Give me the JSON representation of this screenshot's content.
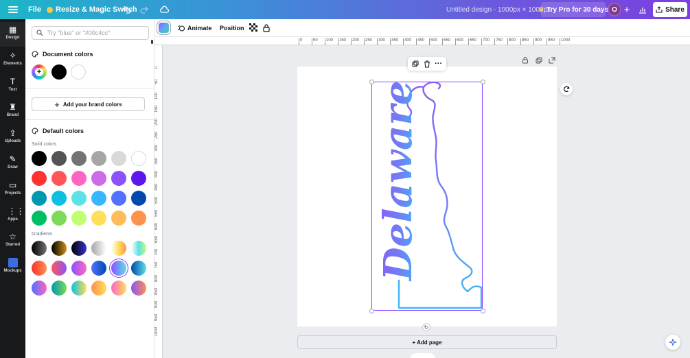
{
  "topbar": {
    "file_label": "File",
    "resize_label": "Resize & Magic Switch",
    "resize_icon": "magic-sparkle-icon",
    "undo_icon": "undo-icon",
    "redo_icon": "redo-icon",
    "cloud_icon": "cloud-save-icon",
    "document_title": "Untitled design - 1000px × 1000px",
    "try_pro_label": "Try Pro for 30 days",
    "avatar_initial": "O",
    "share_label": "Share"
  },
  "rail": {
    "items": [
      {
        "label": "Design",
        "icon": "design-icon",
        "active": true
      },
      {
        "label": "Elements",
        "icon": "elements-icon"
      },
      {
        "label": "Text",
        "icon": "text-icon"
      },
      {
        "label": "Brand",
        "icon": "brand-icon"
      },
      {
        "label": "Uploads",
        "icon": "uploads-icon"
      },
      {
        "label": "Draw",
        "icon": "draw-icon"
      },
      {
        "label": "Projects",
        "icon": "projects-icon"
      },
      {
        "label": "Apps",
        "icon": "apps-icon"
      },
      {
        "label": "Starred",
        "icon": "star-icon"
      },
      {
        "label": "Mockups",
        "icon": "mockups-icon"
      }
    ]
  },
  "panel": {
    "search_placeholder": "Try \"blue\" or \"#00c4cc\"",
    "document_colors_title": "Document colors",
    "document_colors": [
      "#000000",
      "#ffffff"
    ],
    "add_brand_label": "Add your brand colors",
    "default_colors_title": "Default colors",
    "solid_colors_label": "Solid colors",
    "solid_colors": [
      [
        "#000000",
        "#545454",
        "#737373",
        "#a6a6a6",
        "#d9d9d9",
        "#ffffff"
      ],
      [
        "#ff3131",
        "#ff5757",
        "#ff66c4",
        "#cb6ce6",
        "#8c52ff",
        "#5e17eb"
      ],
      [
        "#0097b2",
        "#0cc0df",
        "#5ce1e6",
        "#38b6ff",
        "#5271ff",
        "#004aad"
      ],
      [
        "#00bf63",
        "#7ed957",
        "#c1ff72",
        "#ffde59",
        "#ffbd59",
        "#ff914d"
      ]
    ],
    "gradients_label": "Gradients",
    "gradients": [
      [
        "linear-gradient(90deg,#000000,#737373)",
        "linear-gradient(90deg,#000000,#c89116)",
        "linear-gradient(90deg,#000000,#3533cd)",
        "linear-gradient(90deg,#a6a6a6,#ffffff)",
        "linear-gradient(90deg,#ffffff,#ffde59,#ff914d)",
        "linear-gradient(90deg,#ffffff,#5de0e6,#c1ff72)"
      ],
      [
        "linear-gradient(90deg,#ff3131,#ff914d)",
        "linear-gradient(90deg,#ff5757,#8c52ff)",
        "linear-gradient(90deg,#8c52ff,#ff66c4)",
        "linear-gradient(90deg,#5170ff,#004aad)",
        "linear-gradient(90deg,#8c52ff,#5ce1e6)",
        "linear-gradient(90deg,#004aad,#5de0e6)"
      ],
      [
        "linear-gradient(90deg,#5170ff,#ff66c4)",
        "linear-gradient(90deg,#0097b2,#7ed957)",
        "linear-gradient(90deg,#0cc0df,#ffde59)",
        "linear-gradient(90deg,#ff914d,#ffde59)",
        "linear-gradient(90deg,#ff66c4,#ffde59)",
        "linear-gradient(90deg,#8c52ff,#ff914d)"
      ]
    ],
    "selected_gradient_index": [
      1,
      4
    ]
  },
  "ctxbar": {
    "animate_label": "Animate",
    "position_label": "Position",
    "transparency_icon": "transparency-icon",
    "lock_icon": "lock-icon"
  },
  "ruler": {
    "top_ticks": [
      "0",
      "50",
      "100",
      "150",
      "200",
      "250",
      "300",
      "350",
      "400",
      "450",
      "500",
      "550",
      "600",
      "650",
      "700",
      "750",
      "800",
      "850",
      "900",
      "950",
      "1000"
    ],
    "left_ticks": [
      "0",
      "50",
      "100",
      "150",
      "200",
      "250",
      "300",
      "350",
      "400",
      "450",
      "500",
      "550",
      "600",
      "650",
      "700",
      "750",
      "800",
      "850",
      "900",
      "950",
      "1000"
    ]
  },
  "canvas": {
    "artwork_text": "Delaware",
    "add_page_label": "+ Add page",
    "element_tools": [
      "copy-icon",
      "delete-icon",
      "more-icon"
    ],
    "page_tools": [
      "lock-icon",
      "duplicate-icon",
      "add-page-icon"
    ]
  },
  "colors": {
    "accent": "#8b3dff",
    "art_purple": "#8b5cf6",
    "art_blue": "#38bdf8"
  }
}
